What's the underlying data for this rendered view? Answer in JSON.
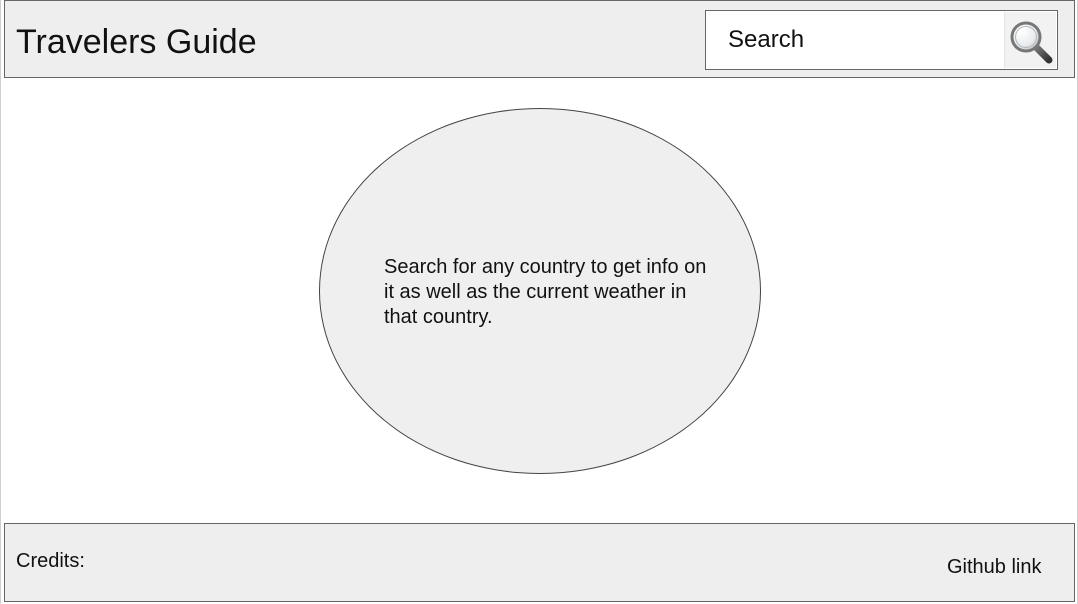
{
  "header": {
    "title": "Travelers Guide",
    "search": {
      "placeholder": "Search",
      "value": "",
      "button_icon": "search-icon"
    }
  },
  "main": {
    "intro_text": "Search for any country to get info on it as well as the current weather in that country."
  },
  "footer": {
    "credits_label": "Credits:",
    "github_link_label": "Github link"
  },
  "colors": {
    "panel_background": "#eeeeee",
    "border": "#666666",
    "page_background": "#ffffff",
    "text": "#111111"
  }
}
